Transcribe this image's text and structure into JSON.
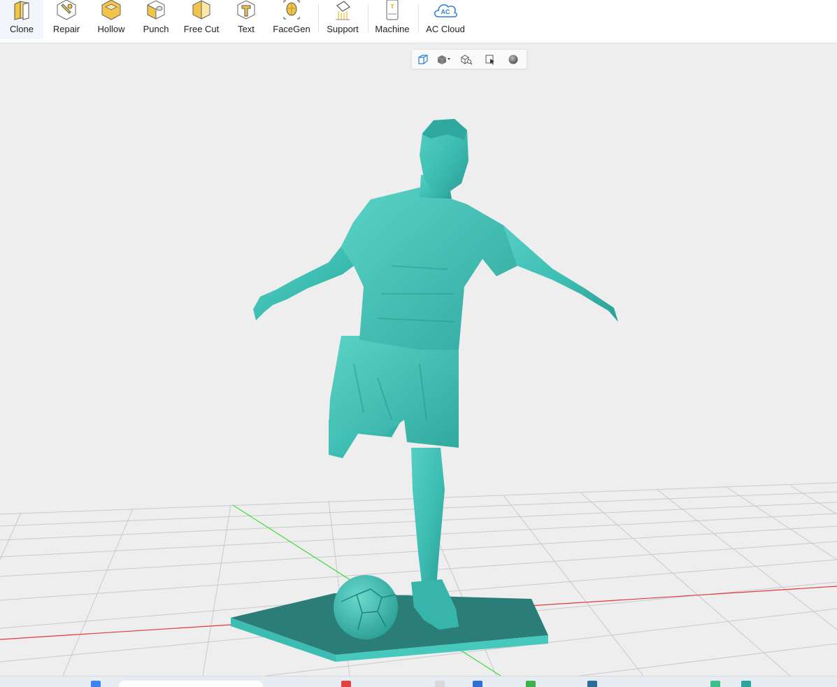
{
  "toolbar": {
    "items": [
      {
        "label": "Clone",
        "icon": "clone-icon"
      },
      {
        "label": "Repair",
        "icon": "repair-icon"
      },
      {
        "label": "Hollow",
        "icon": "hollow-icon"
      },
      {
        "label": "Punch",
        "icon": "punch-icon"
      },
      {
        "label": "Free Cut",
        "icon": "free-cut-icon"
      },
      {
        "label": "Text",
        "icon": "text-icon"
      },
      {
        "label": "FaceGen",
        "icon": "facegen-icon"
      },
      {
        "label": "Support",
        "icon": "support-icon"
      },
      {
        "label": "Machine",
        "icon": "machine-icon"
      },
      {
        "label": "AC Cloud",
        "icon": "ac-cloud-icon"
      }
    ],
    "cloud_icon_text": "AC"
  },
  "viewbar": {
    "buttons": [
      "perspective-cube-icon",
      "view-direction-dropdown-icon",
      "zoom-fit-icon",
      "select-in-view-icon",
      "render-sphere-icon"
    ]
  },
  "viewport": {
    "model": "soccer-player-statue",
    "model_color": "#3dbdb2",
    "base_color": "#2b918a",
    "x_axis_color": "#e03a3a",
    "y_axis_color": "#3ddc3d",
    "grid_color": "#c9c9cc",
    "background": "#eeeeef"
  },
  "colors": {
    "accent_icon": "#f3c44a",
    "icon_outline": "#555555",
    "cloud_blue": "#2d7fd6"
  }
}
